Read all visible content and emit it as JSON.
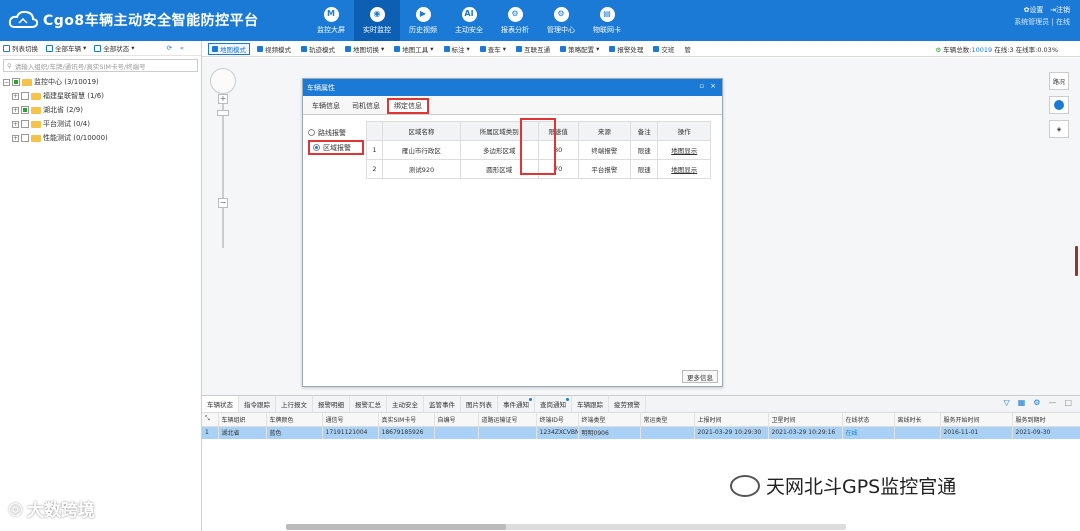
{
  "app": {
    "title": "Cgo8车辆主动安全智能防控平台"
  },
  "nav": [
    {
      "label": "监控大屏",
      "icon": "M"
    },
    {
      "label": "实时监控",
      "icon": "◉"
    },
    {
      "label": "历史视频",
      "icon": "▶"
    },
    {
      "label": "主动安全",
      "icon": "AI"
    },
    {
      "label": "报表分析",
      "icon": "⚙"
    },
    {
      "label": "管理中心",
      "icon": "⚙"
    },
    {
      "label": "物联网卡",
      "icon": "▤"
    }
  ],
  "top_right": {
    "settings": "设置",
    "logout": "注销",
    "user": "系统管理员 | 在线"
  },
  "left": {
    "tools": [
      "列表切换",
      "全部车辆",
      "全部状态"
    ],
    "search_placeholder": "请输入组织/车牌/通讯号/真实SIM卡号/终端号",
    "tree": [
      {
        "label": "监控中心 (3/10019)",
        "level": 0
      },
      {
        "label": "福建星联智慧 (1/6)",
        "level": 1
      },
      {
        "label": "湖北省 (2/9)",
        "level": 1
      },
      {
        "label": "平台测试 (0/4)",
        "level": 1
      },
      {
        "label": "性能测试 (0/10000)",
        "level": 1
      }
    ]
  },
  "toolbar": {
    "buttons": [
      "地图模式",
      "视频模式",
      "轨迹模式",
      "地图切换",
      "地图工具",
      "标注",
      "查车",
      "互联互通",
      "策略配置",
      "报警处理",
      "交班",
      "管"
    ],
    "stats_label": "车辆总数:",
    "stats_total": "10019",
    "online_label": "在线:3",
    "rate_label": "在线率:0.03%"
  },
  "map_tools": [
    "路况",
    "卫星",
    "图层"
  ],
  "dialog": {
    "title": "车辆属性",
    "tabs": [
      "车辆信息",
      "司机信息",
      "绑定信息"
    ],
    "radios": [
      "路线报警",
      "区域报警"
    ],
    "headers": [
      "区域名称",
      "所属区域类别",
      "限速值",
      "来源",
      "备注",
      "操作"
    ],
    "rows": [
      {
        "no": "1",
        "name": "雁山市行政区",
        "type": "多边形区域",
        "limit": "80",
        "source": "终端报警",
        "note": "限速",
        "op": "地图显示"
      },
      {
        "no": "2",
        "name": "测试920",
        "type": "圆形区域",
        "limit": "70",
        "source": "平台报警",
        "note": "限速",
        "op": "地图显示"
      }
    ],
    "more": "更多信息"
  },
  "bottom": {
    "tabs": [
      "车辆状态",
      "指令跟踪",
      "上行报文",
      "报警明细",
      "报警汇总",
      "主动安全",
      "监管事件",
      "图片列表",
      "事件通知",
      "查岗通知",
      "车辆跟踪",
      "疲劳预警"
    ],
    "columns": [
      "车辆组织",
      "车牌颜色",
      "通信号",
      "真实SIM卡号",
      "自编号",
      "道路运输证号",
      "终端ID号",
      "终端类型",
      "常运类型",
      "上报时间",
      "卫星时间",
      "在线状态",
      "离线时长",
      "服务开始时间",
      "服务到期时"
    ],
    "row": {
      "idx": "1",
      "org": "湖北省",
      "color": "蓝色",
      "comm": "17191121004",
      "sim": "18679185926",
      "self": "",
      "road": "",
      "tid": "1234ZXCVBN",
      "ttype": "明明0906",
      "ctype": "",
      "report": "2021-03-29 10:29:30",
      "sat": "2021-03-29 10:29:16",
      "status": "在线",
      "offline": "",
      "start": "2016-11-01",
      "end": "2021-09-30"
    }
  },
  "watermarks": {
    "left": "大数跨境",
    "right": "天网北斗GPS监控官通"
  }
}
